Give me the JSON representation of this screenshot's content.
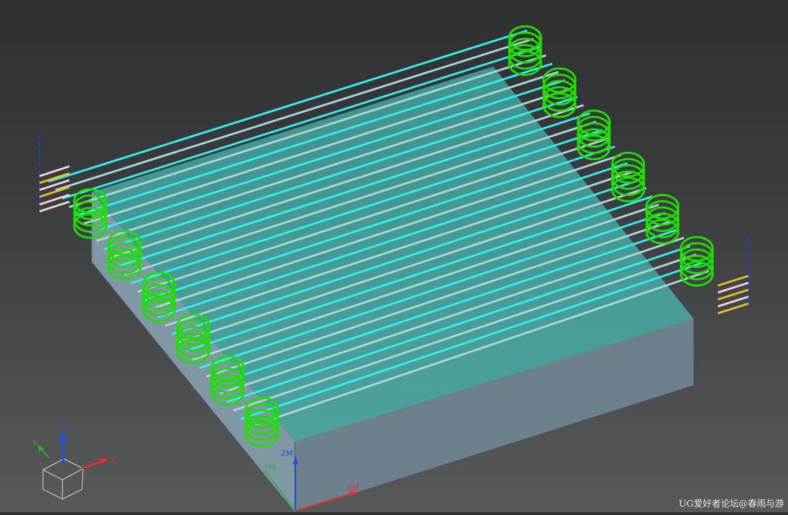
{
  "viewport": {
    "background_top": "#2f3031",
    "background_bottom": "#585959"
  },
  "colors": {
    "stock_top": "#4ae3d9",
    "stock_side_left": "#7f98a4",
    "stock_side_front": "#6d818d",
    "cut_pass": "#36ecf0",
    "cut_pass_light": "#a9d6dc",
    "stepover_loop": "#1ee000",
    "engage": "#e8c020",
    "retract": "#f0d6e6",
    "rapid": "#1d3bd6",
    "axis_x": "#e03030",
    "axis_y": "#30b030",
    "axis_z": "#2050e0"
  },
  "triad": {
    "x_label": "X",
    "y_label": "Y",
    "z_label": "Z"
  },
  "mcs": {
    "x_label": "XM",
    "y_label": "YM",
    "z_label": "ZM"
  },
  "toolpath": {
    "pass_count": 30,
    "loop_groups": 6,
    "loops_per_group": 5
  },
  "watermark": "UG爱好者论坛@春雨与游"
}
